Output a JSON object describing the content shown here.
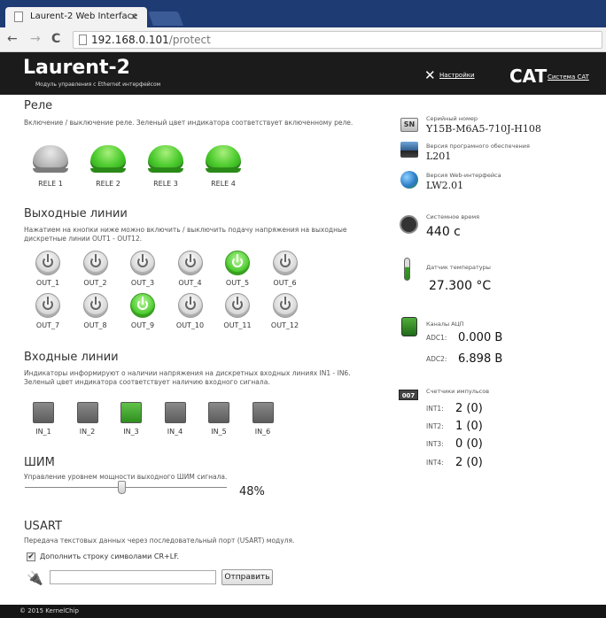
{
  "browser": {
    "tab_title": "Laurent-2 Web Interface",
    "tab_close": "×",
    "url_host": "192.168.0.101",
    "url_path": "/protect",
    "nav_back": "←",
    "nav_forward": "→",
    "nav_reload": "C"
  },
  "header": {
    "brand": "Laurent-2",
    "subtitle": "Модуль управления с Ethernet интерфейсом",
    "settings_label": "Настройки",
    "cat_logo": "CAT",
    "cat_link": "Система CAT"
  },
  "relays": {
    "title": "Реле",
    "description": "Включение / выключение реле. Зеленый цвет индикатора соответствует включенному реле.",
    "items": [
      {
        "label": "RELE 1",
        "on": false
      },
      {
        "label": "RELE 2",
        "on": true
      },
      {
        "label": "RELE 3",
        "on": true
      },
      {
        "label": "RELE 4",
        "on": true
      }
    ]
  },
  "outputs": {
    "title": "Выходные линии",
    "description": "Нажатием на кнопки ниже можно включить / выключить подачу напряжения на выходные дискретные линии OUT1 - OUT12.",
    "items": [
      {
        "label": "OUT_1",
        "on": false
      },
      {
        "label": "OUT_2",
        "on": false
      },
      {
        "label": "OUT_3",
        "on": false
      },
      {
        "label": "OUT_4",
        "on": false
      },
      {
        "label": "OUT_5",
        "on": true
      },
      {
        "label": "OUT_6",
        "on": false
      },
      {
        "label": "OUT_7",
        "on": false
      },
      {
        "label": "OUT_8",
        "on": false
      },
      {
        "label": "OUT_9",
        "on": true
      },
      {
        "label": "OUT_10",
        "on": false
      },
      {
        "label": "OUT_11",
        "on": false
      },
      {
        "label": "OUT_12",
        "on": false
      }
    ]
  },
  "inputs": {
    "title": "Входные линии",
    "description": "Индикаторы информируют о наличии напряжения на дискретных входных линиях IN1 - IN6. Зеленый цвет индикатора соответствует наличию входного сигнала.",
    "items": [
      {
        "label": "IN_1",
        "on": false
      },
      {
        "label": "IN_2",
        "on": false
      },
      {
        "label": "IN_3",
        "on": true
      },
      {
        "label": "IN_4",
        "on": false
      },
      {
        "label": "IN_5",
        "on": false
      },
      {
        "label": "IN_6",
        "on": false
      }
    ]
  },
  "pwm": {
    "title": "ШИМ",
    "description": "Управление уровнем мощности выходного ШИМ сигнала.",
    "value": "48%",
    "level": 0.48
  },
  "usart": {
    "title": "USART",
    "description": "Передача текстовых данных через последовательный порт (USART) модуля.",
    "crlf_label": "Дополнить строку символами CR+LF.",
    "crlf_checked": true,
    "input_value": "",
    "send_label": "Отправить"
  },
  "info": {
    "serial_label": "Серийный номер",
    "serial_value": "Y15B-M6A5-710J-H108",
    "sn_badge": "SN",
    "fw_label": "Версия програмного обеспечения",
    "fw_value": "L201",
    "web_label": "Версия Web-интерфейса",
    "web_value": "LW2.01",
    "time_label": "Системное время",
    "time_value": "440 с",
    "temp_label": "Датчик температуры",
    "temp_value": "27.300 °C",
    "adc_label": "Каналы АЦП",
    "adc": [
      {
        "key": "ADC1:",
        "value": "0.000 В"
      },
      {
        "key": "ADC2:",
        "value": "6.898 В"
      }
    ],
    "counters_label": "Счетчики импульсов",
    "counter_badge": "007",
    "counters": [
      {
        "key": "INT1:",
        "value": "2 (0)"
      },
      {
        "key": "INT2:",
        "value": "1 (0)"
      },
      {
        "key": "INT3:",
        "value": "0 (0)"
      },
      {
        "key": "INT4:",
        "value": "2 (0)"
      }
    ]
  },
  "footer": {
    "copyright": "© 2015 KernelChip"
  }
}
